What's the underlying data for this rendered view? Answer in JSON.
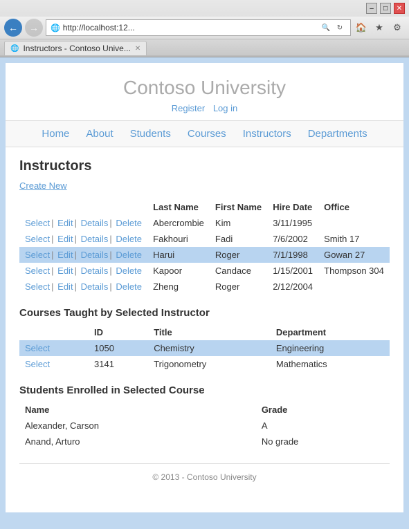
{
  "browser": {
    "address": "http://localhost:12...",
    "tab_title": "Instructors - Contoso Unive...",
    "title_bar_buttons": {
      "minimize": "–",
      "maximize": "□",
      "close": "✕"
    }
  },
  "site": {
    "title": "Contoso University",
    "register_label": "Register",
    "login_label": "Log in"
  },
  "nav": {
    "items": [
      {
        "label": "Home"
      },
      {
        "label": "About"
      },
      {
        "label": "Students"
      },
      {
        "label": "Courses"
      },
      {
        "label": "Instructors"
      },
      {
        "label": "Departments"
      }
    ]
  },
  "page": {
    "heading": "Instructors",
    "create_new": "Create New",
    "table": {
      "columns": [
        "",
        "Last Name",
        "First Name",
        "Hire Date",
        "Office"
      ],
      "rows": [
        {
          "actions": [
            "Select",
            "Edit",
            "Details",
            "Delete"
          ],
          "last": "Abercrombie",
          "first": "Kim",
          "hire": "3/11/1995",
          "office": "",
          "selected": false
        },
        {
          "actions": [
            "Select",
            "Edit",
            "Details",
            "Delete"
          ],
          "last": "Fakhouri",
          "first": "Fadi",
          "hire": "7/6/2002",
          "office": "Smith 17",
          "selected": false
        },
        {
          "actions": [
            "Select",
            "Edit",
            "Details",
            "Delete"
          ],
          "last": "Harui",
          "first": "Roger",
          "hire": "7/1/1998",
          "office": "Gowan 27",
          "selected": true
        },
        {
          "actions": [
            "Select",
            "Edit",
            "Details",
            "Delete"
          ],
          "last": "Kapoor",
          "first": "Candace",
          "hire": "1/15/2001",
          "office": "Thompson 304",
          "selected": false
        },
        {
          "actions": [
            "Select",
            "Edit",
            "Details",
            "Delete"
          ],
          "last": "Zheng",
          "first": "Roger",
          "hire": "2/12/2004",
          "office": "",
          "selected": false
        }
      ]
    },
    "courses_section": {
      "title": "Courses Taught by Selected Instructor",
      "columns": [
        "ID",
        "Title",
        "Department"
      ],
      "rows": [
        {
          "id": "1050",
          "title": "Chemistry",
          "department": "Engineering",
          "selected": true
        },
        {
          "id": "3141",
          "title": "Trigonometry",
          "department": "Mathematics",
          "selected": false
        }
      ],
      "select_label": "Select"
    },
    "students_section": {
      "title": "Students Enrolled in Selected Course",
      "columns": [
        "Name",
        "Grade"
      ],
      "rows": [
        {
          "name": "Alexander, Carson",
          "grade": "A"
        },
        {
          "name": "Anand, Arturo",
          "grade": "No grade"
        }
      ]
    }
  },
  "footer": {
    "text": "© 2013 - Contoso University"
  }
}
